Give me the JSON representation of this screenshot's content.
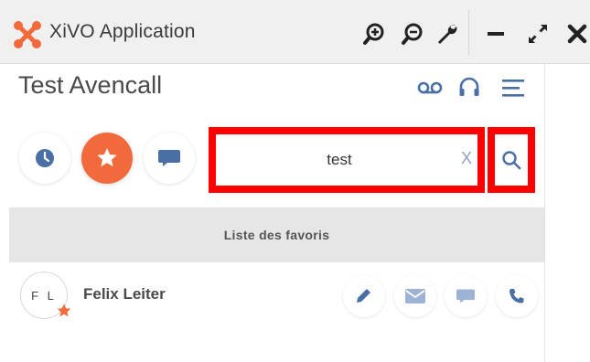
{
  "window": {
    "title": "XiVO Application",
    "controls": {
      "zoom_in": "zoom-in-icon",
      "zoom_out": "zoom-out-icon",
      "settings": "wrench-icon",
      "minimize": "minimize-icon",
      "expand": "expand-icon",
      "close": "close-icon"
    }
  },
  "header": {
    "user_name": "Test Avencall",
    "icons": [
      "voicemail-icon",
      "headset-icon",
      "menu-icon"
    ]
  },
  "nav": {
    "buttons": [
      {
        "name": "history",
        "icon": "clock-icon",
        "active": false
      },
      {
        "name": "favorites",
        "icon": "star-icon",
        "active": true
      },
      {
        "name": "chat",
        "icon": "chat-icon",
        "active": false
      }
    ]
  },
  "search": {
    "value": "test",
    "clear_label": "X"
  },
  "section": {
    "title": "Liste des favoris"
  },
  "contacts": [
    {
      "initials": "F L",
      "name": "Felix Leiter",
      "favorite": true,
      "actions": [
        "edit-icon",
        "email-icon",
        "chat-icon",
        "phone-icon"
      ]
    }
  ],
  "colors": {
    "accent": "#f26a3b",
    "icon_blue": "#4a6fa5",
    "icon_light_blue": "#9db3d6",
    "highlight": "#ff0000",
    "section_bg": "#e6e6e6"
  }
}
